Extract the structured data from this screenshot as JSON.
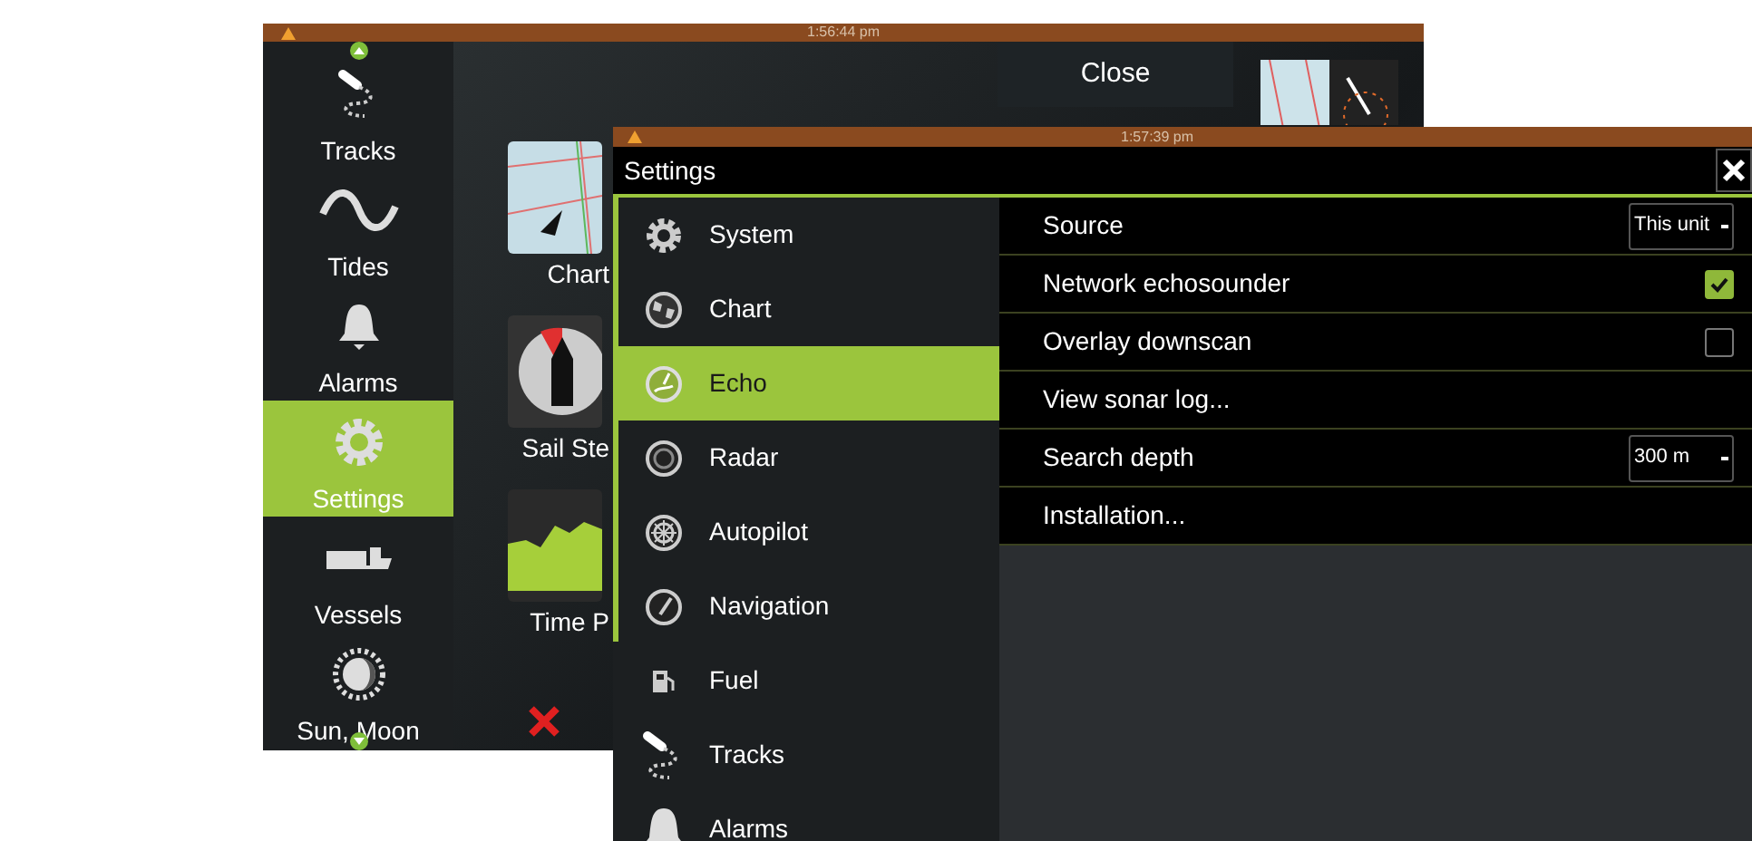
{
  "back_screen": {
    "status_time": "1:56:44 pm",
    "sidebar": [
      {
        "label": "Tracks",
        "kind": "tracks",
        "selected": false
      },
      {
        "label": "Tides",
        "kind": "tides",
        "selected": false
      },
      {
        "label": "Alarms",
        "kind": "alarms",
        "selected": false
      },
      {
        "label": "Settings",
        "kind": "settings",
        "selected": true
      },
      {
        "label": "Vessels",
        "kind": "vessels",
        "selected": false
      },
      {
        "label": "Sun, Moon",
        "kind": "sun",
        "selected": false
      }
    ],
    "tiles": [
      {
        "label": "Chart",
        "kind": "chart"
      },
      {
        "label": "Sail Ste",
        "kind": "gauge"
      },
      {
        "label": "Time P",
        "kind": "plot"
      }
    ],
    "close_button": "Close"
  },
  "settings": {
    "status_time": "1:57:39 pm",
    "title": "Settings",
    "categories": [
      {
        "label": "System",
        "kind": "system",
        "selected": false
      },
      {
        "label": "Chart",
        "kind": "chart",
        "selected": false
      },
      {
        "label": "Echo",
        "kind": "echo",
        "selected": true
      },
      {
        "label": "Radar",
        "kind": "radar",
        "selected": false
      },
      {
        "label": "Autopilot",
        "kind": "autopilot",
        "selected": false
      },
      {
        "label": "Navigation",
        "kind": "navigation",
        "selected": false
      },
      {
        "label": "Fuel",
        "kind": "fuel",
        "selected": false
      },
      {
        "label": "Tracks",
        "kind": "tracks",
        "selected": false
      },
      {
        "label": "Alarms",
        "kind": "alarms",
        "selected": false
      }
    ],
    "options": [
      {
        "label": "Source",
        "kind": "dropdown",
        "value": "This unit"
      },
      {
        "label": "Network echosounder",
        "kind": "checkbox",
        "checked": true
      },
      {
        "label": "Overlay downscan",
        "kind": "checkbox",
        "checked": false
      },
      {
        "label": "View sonar log...",
        "kind": "link"
      },
      {
        "label": "Search depth",
        "kind": "dropdown",
        "value": "300 m"
      },
      {
        "label": "Installation...",
        "kind": "link"
      }
    ]
  }
}
